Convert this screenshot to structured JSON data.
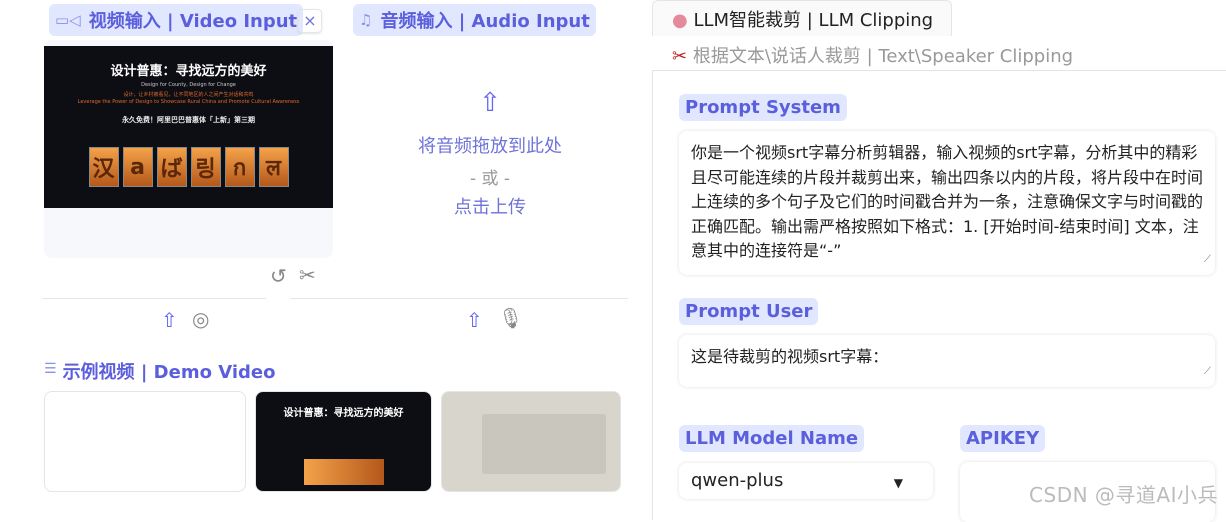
{
  "video_input": {
    "label": "视频输入 | Video Input",
    "icon": "video-camera-icon",
    "close": "×",
    "preview": {
      "title": "设计普惠：寻找远方的美好",
      "subtitle": "Design for County, Design for Change",
      "red_line": "设计，让乡村被看见，让不同地区的人之间产生对话和共鸣",
      "red_line_en": "Leverage the Power of Design to Showcase Rural China and Promote Cultural Awareness",
      "event": "永久免费！阿里巴巴普惠体「上新」第三期",
      "blocks": [
        "汉",
        "a",
        "ば",
        "링",
        "ก",
        "ल"
      ]
    }
  },
  "audio_input": {
    "label": "音频输入 | Audio Input",
    "icon": "music-note-icon",
    "drop_text": "将音频拖放到此处",
    "or_text": "- 或 -",
    "click_text": "点击上传"
  },
  "demo": {
    "label": "示例视频 | Demo Video",
    "icon": "list-icon",
    "thumb2_title": "设计普惠：寻找远方的美好"
  },
  "tabs": [
    {
      "label": "LLM智能裁剪 | LLM Clipping",
      "icon": "brain-icon",
      "active": true
    },
    {
      "label": "根据文本\\说话人裁剪 | Text\\Speaker Clipping",
      "icon": "scissors-icon",
      "active": false
    }
  ],
  "prompt_system": {
    "label": "Prompt System",
    "value": "你是一个视频srt字幕分析剪辑器，输入视频的srt字幕，分析其中的精彩且尽可能连续的片段并裁剪出来，输出四条以内的片段，将片段中在时间上连续的多个句子及它们的时间戳合并为一条，注意确保文字与时间戳的正确匹配。输出需严格按照如下格式：1. [开始时间-结束时间] 文本，注意其中的连接符是“-”"
  },
  "prompt_user": {
    "label": "Prompt User",
    "value": "这是待裁剪的视频srt字幕："
  },
  "model": {
    "label": "LLM Model Name",
    "value": "qwen-plus"
  },
  "apikey": {
    "label": "APIKEY",
    "value": ""
  },
  "watermark": "CSDN @寻道AI小兵",
  "colors": {
    "accent": "#5c5fdc",
    "label_bg": "#e0e7ff"
  }
}
